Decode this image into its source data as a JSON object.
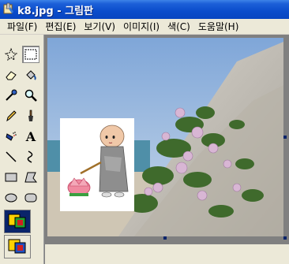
{
  "window": {
    "title": "k8.jpg - 그림판"
  },
  "menu": {
    "items": [
      "파일(F)",
      "편집(E)",
      "보기(V)",
      "이미지(I)",
      "색(C)",
      "도움말(H)"
    ]
  },
  "tools": [
    {
      "name": "free-select-icon"
    },
    {
      "name": "rect-select-icon",
      "selected": true
    },
    {
      "name": "eraser-icon"
    },
    {
      "name": "fill-bucket-icon"
    },
    {
      "name": "color-picker-icon"
    },
    {
      "name": "magnifier-icon"
    },
    {
      "name": "pencil-icon"
    },
    {
      "name": "brush-icon"
    },
    {
      "name": "airbrush-icon"
    },
    {
      "name": "text-icon",
      "label": "A"
    },
    {
      "name": "line-icon"
    },
    {
      "name": "curve-icon"
    },
    {
      "name": "rectangle-icon"
    },
    {
      "name": "polygon-icon"
    },
    {
      "name": "ellipse-icon"
    },
    {
      "name": "rounded-rect-icon"
    }
  ],
  "colors": {
    "titlebar": "#0a4ccb",
    "chrome": "#ece9d8",
    "workspace": "#808080"
  }
}
